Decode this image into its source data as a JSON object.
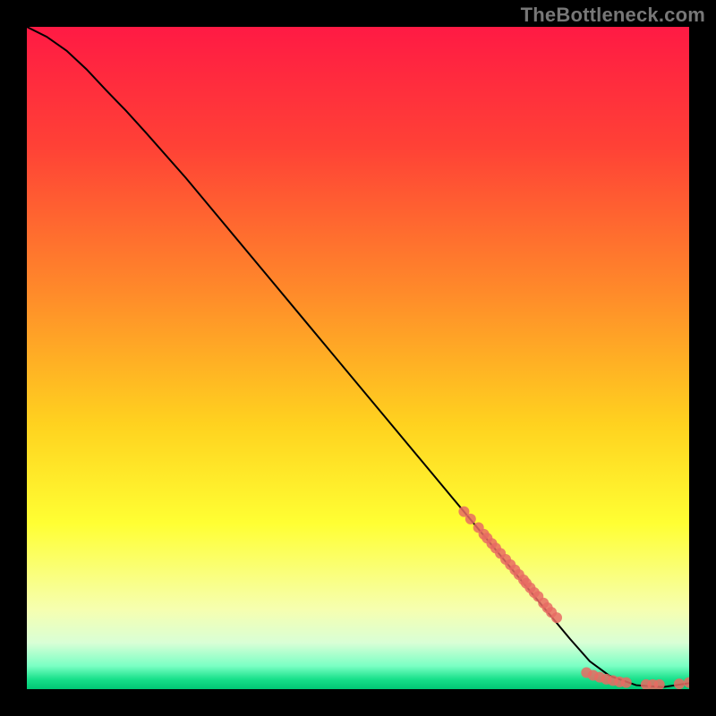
{
  "watermark": "TheBottleneck.com",
  "chart_data": {
    "type": "line",
    "title": "",
    "xlabel": "",
    "ylabel": "",
    "xlim": [
      0,
      100
    ],
    "ylim": [
      0,
      100
    ],
    "grid": false,
    "legend": false,
    "background_gradient_stops": [
      {
        "offset": 0.0,
        "color": "#ff1a44"
      },
      {
        "offset": 0.18,
        "color": "#ff4136"
      },
      {
        "offset": 0.4,
        "color": "#ff8a2a"
      },
      {
        "offset": 0.6,
        "color": "#ffd21f"
      },
      {
        "offset": 0.75,
        "color": "#ffff33"
      },
      {
        "offset": 0.88,
        "color": "#f6ffb0"
      },
      {
        "offset": 0.93,
        "color": "#d9ffd6"
      },
      {
        "offset": 0.965,
        "color": "#7affc4"
      },
      {
        "offset": 0.985,
        "color": "#18e08a"
      },
      {
        "offset": 1.0,
        "color": "#00c774"
      }
    ],
    "series": [
      {
        "name": "bottleneck-curve",
        "color": "#000000",
        "x": [
          0,
          3,
          6,
          9,
          12,
          15,
          18,
          24,
          30,
          36,
          42,
          48,
          54,
          60,
          66,
          72,
          78,
          82,
          85,
          88,
          92,
          96,
          100
        ],
        "y": [
          100,
          98.5,
          96.4,
          93.6,
          90.4,
          87.3,
          84.0,
          77.2,
          70.0,
          62.8,
          55.6,
          48.4,
          41.2,
          34.0,
          26.8,
          19.6,
          12.4,
          7.6,
          4.2,
          2.0,
          0.6,
          0.3,
          0.9
        ]
      }
    ],
    "markers": {
      "name": "highlight-points",
      "color": "#e86b63",
      "radius_px": 6,
      "x": [
        66,
        67,
        68.2,
        69,
        69.5,
        70.2,
        70.8,
        71.5,
        72.3,
        73,
        73.7,
        74.3,
        75,
        75.4,
        76,
        76.6,
        77.2,
        78,
        78.6,
        79.2,
        80,
        84.5,
        85.5,
        86.5,
        87.5,
        88.5,
        89.5,
        90.5,
        93.5,
        94.5,
        95.5,
        98.5,
        100
      ],
      "y": [
        26.8,
        25.7,
        24.4,
        23.4,
        22.8,
        22.0,
        21.3,
        20.5,
        19.6,
        18.8,
        18.0,
        17.3,
        16.5,
        16.0,
        15.3,
        14.6,
        14.0,
        13.0,
        12.3,
        11.6,
        10.8,
        2.5,
        2.1,
        1.8,
        1.5,
        1.3,
        1.1,
        1.0,
        0.7,
        0.7,
        0.7,
        0.8,
        1.0
      ]
    }
  }
}
